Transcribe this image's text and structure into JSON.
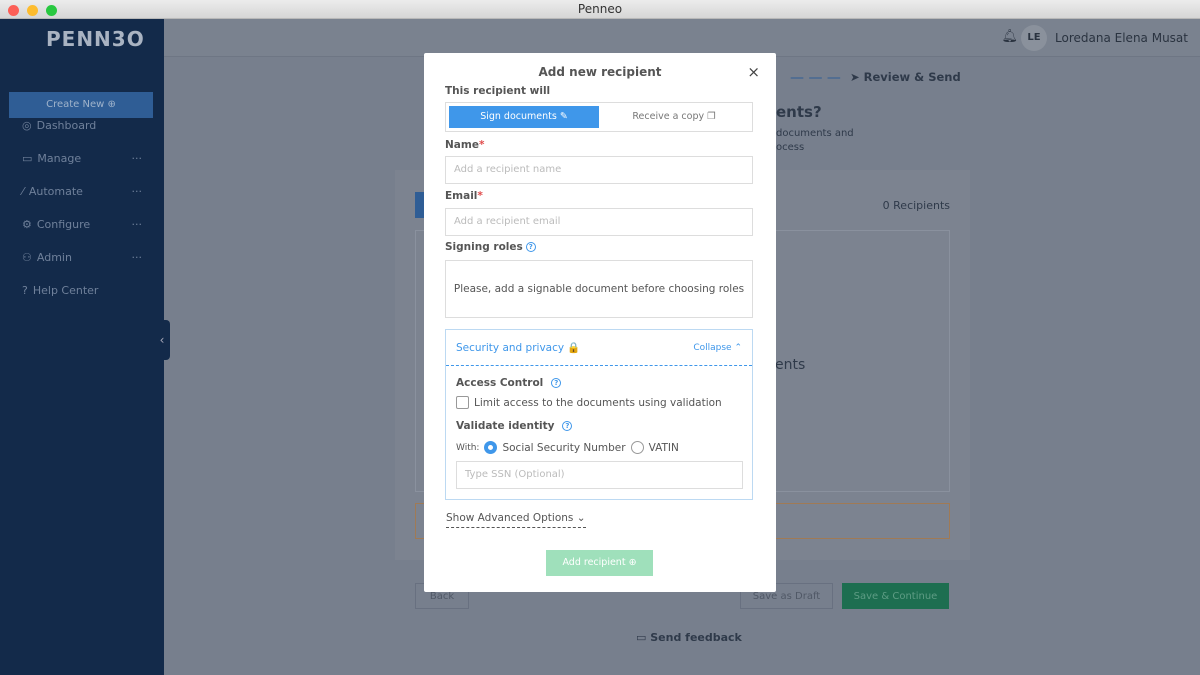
{
  "window": {
    "title": "Penneo"
  },
  "sidebar": {
    "logo": "PENN3O",
    "create_new": "Create New ⊕",
    "items": [
      {
        "label": "Dashboard",
        "icon": "◎",
        "more": ""
      },
      {
        "label": "Manage",
        "icon": "▭",
        "more": "···"
      },
      {
        "label": "Automate",
        "icon": "⁄",
        "more": "···"
      },
      {
        "label": "Configure",
        "icon": "⚙",
        "more": "···"
      },
      {
        "label": "Admin",
        "icon": "⚇",
        "more": "···"
      },
      {
        "label": "Help Center",
        "icon": "?",
        "more": ""
      }
    ]
  },
  "header": {
    "user_initials": "LE",
    "user_name": "Loredana Elena Musat"
  },
  "background": {
    "step_review": "Review & Send",
    "heading_fragment": "ents?",
    "sub1": "documents and",
    "sub2": "ocess",
    "recipients_count": "0 Recipients",
    "empty_fragment": "ents",
    "back": "Back",
    "save_draft": "Save as Draft",
    "save_continue": "Save & Continue",
    "feedback": "Send feedback"
  },
  "modal": {
    "title": "Add new recipient",
    "close": "×",
    "recipient_will": "This recipient will",
    "sign_documents": "Sign documents ✎",
    "receive_copy": "Receive a copy ❐",
    "name_label": "Name",
    "name_placeholder": "Add a recipient name",
    "email_label": "Email",
    "email_placeholder": "Add a recipient email",
    "required_mark": "*",
    "signing_roles_label": "Signing roles",
    "signing_roles_message": "Please, add a signable document before choosing roles",
    "security": {
      "title": "Security and privacy 🔒",
      "collapse": "Collapse ⌃",
      "access_control": "Access Control",
      "limit_access": "Limit access to the documents using validation",
      "validate_identity": "Validate identity",
      "with": "With:",
      "ssn": "Social Security Number",
      "vatin": "VATIN",
      "ssn_placeholder": "Type SSN (Optional)"
    },
    "show_advanced": "Show Advanced Options ⌄",
    "add_recipient": "Add recipient ⊕"
  }
}
